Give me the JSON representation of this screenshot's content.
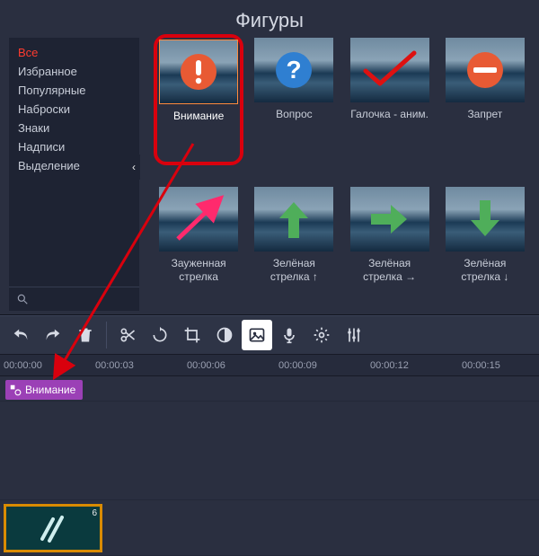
{
  "panel": {
    "title": "Фигуры"
  },
  "sidebar": {
    "items": [
      {
        "label": "Все",
        "active": true
      },
      {
        "label": "Избранное",
        "active": false
      },
      {
        "label": "Популярные",
        "active": false
      },
      {
        "label": "Наброски",
        "active": false
      },
      {
        "label": "Знаки",
        "active": false
      },
      {
        "label": "Надписи",
        "active": false
      },
      {
        "label": "Выделение",
        "active": false
      }
    ],
    "search_placeholder": ""
  },
  "shapes": [
    {
      "id": "attention",
      "label": "Внимание",
      "icon": "exclaim",
      "highlighted": true
    },
    {
      "id": "question",
      "label": "Вопрос",
      "icon": "question",
      "highlighted": false
    },
    {
      "id": "check-anim",
      "label": "Галочка - аним.",
      "icon": "check-red",
      "highlighted": false
    },
    {
      "id": "forbid",
      "label": "Запрет",
      "icon": "noentry",
      "highlighted": false
    },
    {
      "id": "narrow-arrow",
      "label": "Зауженная стрелка",
      "icon": "arrow-pink-ne",
      "highlighted": false
    },
    {
      "id": "green-up",
      "label": "Зелёная стрелка ↑",
      "icon": "arrow-green-up",
      "highlighted": false
    },
    {
      "id": "green-right",
      "label": "Зелёная стрелка →",
      "icon": "arrow-green-right",
      "highlighted": false
    },
    {
      "id": "green-down",
      "label": "Зелёная стрелка ↓",
      "icon": "arrow-green-down",
      "highlighted": false
    }
  ],
  "timeline": {
    "marks": [
      "00:00:00",
      "00:00:03",
      "00:00:06",
      "00:00:09",
      "00:00:12",
      "00:00:15"
    ],
    "attention_clip_label": "Внимание",
    "video_clip_duration": "6"
  }
}
